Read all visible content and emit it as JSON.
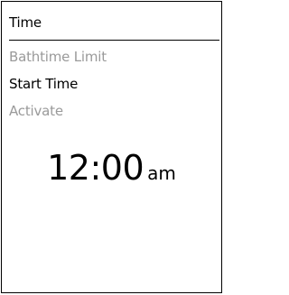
{
  "header": {
    "title": "Time"
  },
  "menu": {
    "items": [
      {
        "label": "Bathtime Limit",
        "state": "inactive"
      },
      {
        "label": "Start Time",
        "state": "active"
      },
      {
        "label": "Activate",
        "state": "inactive"
      }
    ]
  },
  "clock": {
    "time": "12:00",
    "period": "am"
  },
  "colors": {
    "active_text": "#000000",
    "inactive_text": "#9a9a9a",
    "background": "#ffffff",
    "border": "#000000"
  }
}
